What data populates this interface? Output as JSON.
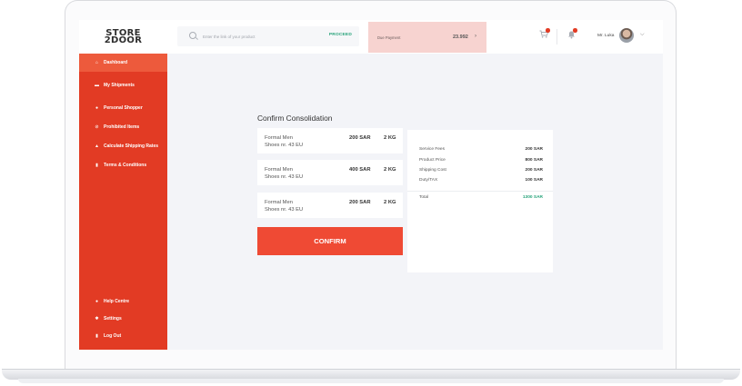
{
  "brand": {
    "logo_line1": "STORE",
    "logo_line2": "2DOOR"
  },
  "search": {
    "placeholder": "Enter the link of your product",
    "action_label": "PROCEED"
  },
  "due": {
    "label": "Due Payment",
    "amount": "23.992",
    "arrow": "›"
  },
  "user": {
    "name": "Mr. Luka",
    "dropdown": "⌵"
  },
  "header_icons": {
    "cart": "cart-icon",
    "notifications": "bell-icon"
  },
  "sidebar": {
    "items": [
      {
        "label": "Dashboard",
        "icon": "home-icon",
        "glyph": "⌂"
      },
      {
        "label": "My Shipments",
        "icon": "truck-icon",
        "glyph": "▬"
      },
      {
        "label": "Personal Shopper",
        "icon": "person-icon",
        "glyph": "●"
      },
      {
        "label": "Prohibited Items",
        "icon": "prohibited-icon",
        "glyph": "⊘"
      },
      {
        "label": "Calculate Shipping Rates",
        "icon": "weight-icon",
        "glyph": "▲"
      },
      {
        "label": "Terms & Conditions",
        "icon": "document-icon",
        "glyph": "▮"
      }
    ],
    "bottom": [
      {
        "label": "Help Centre",
        "icon": "help-icon",
        "glyph": "●"
      },
      {
        "label": "Settings",
        "icon": "gear-icon",
        "glyph": "✱"
      },
      {
        "label": "Log Out",
        "icon": "logout-icon",
        "glyph": "▮"
      }
    ]
  },
  "main": {
    "title": "Confirm Consolidation",
    "items": [
      {
        "name": "Formal Men",
        "size": "Shoes nr. 43 EU",
        "price": "200 SAR",
        "weight": "2 KG"
      },
      {
        "name": "Formal Men",
        "size": "Shoes nr. 43 EU",
        "price": "400 SAR",
        "weight": "2 KG"
      },
      {
        "name": "Formal Men",
        "size": "Shoes nr. 43 EU",
        "price": "200 SAR",
        "weight": "2 KG"
      }
    ],
    "confirm_label": "CONFIRM"
  },
  "summary": {
    "rows": [
      {
        "label": "Service Fees",
        "value": "200 SAR"
      },
      {
        "label": "Product Price",
        "value": "800 SAR"
      },
      {
        "label": "Shipping Cost",
        "value": "200 SAR"
      },
      {
        "label": "Duty/TAX",
        "value": "100 SAR"
      }
    ],
    "total_label": "Total",
    "total_value": "1300 SAR"
  },
  "colors": {
    "brand_red": "#e23b24",
    "accent_green": "#27a37a",
    "due_bg": "#f7d3d0"
  }
}
